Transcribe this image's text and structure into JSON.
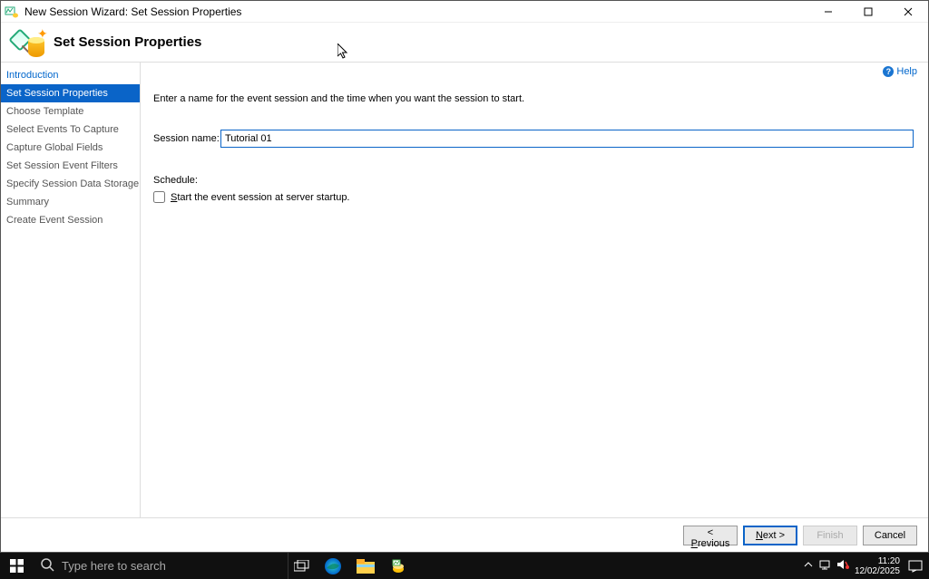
{
  "window": {
    "title": "New Session Wizard: Set Session Properties"
  },
  "header": {
    "title": "Set Session Properties"
  },
  "help": {
    "label": "Help"
  },
  "sidebar": {
    "items": [
      {
        "label": "Introduction",
        "intro": true
      },
      {
        "label": "Set Session Properties",
        "selected": true
      },
      {
        "label": "Choose Template"
      },
      {
        "label": "Select Events To Capture"
      },
      {
        "label": "Capture Global Fields"
      },
      {
        "label": "Set Session Event Filters"
      },
      {
        "label": "Specify Session Data Storage"
      },
      {
        "label": "Summary"
      },
      {
        "label": "Create Event Session"
      }
    ]
  },
  "main": {
    "instruction": "Enter a name for the event session and the time when you want the session to start.",
    "session_name_label": "Session name:",
    "session_name_value": "Tutorial 01",
    "schedule_label": "Schedule:",
    "autostart_prefix": "S",
    "autostart_rest": "tart the event session at server startup."
  },
  "footer": {
    "previous_prefix": "< ",
    "previous_ul": "P",
    "previous_rest": "revious",
    "next_ul": "N",
    "next_rest": "ext >",
    "finish": "Finish",
    "cancel": "Cancel"
  },
  "taskbar": {
    "search_placeholder": "Type here to search",
    "time": "11:20",
    "date": "12/02/2025"
  }
}
